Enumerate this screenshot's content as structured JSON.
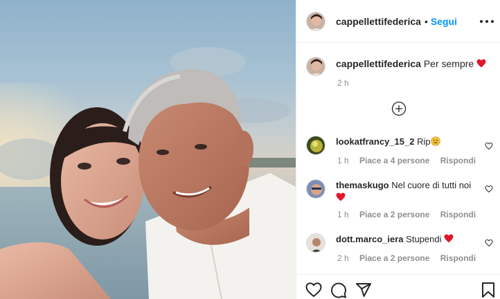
{
  "post": {
    "username": "cappellettifederica",
    "separator": "•",
    "follow_label": "Segui"
  },
  "caption": {
    "username": "cappellettifederica",
    "text": "Per sempre",
    "emoji": "red-heart",
    "time": "2 h"
  },
  "comments": [
    {
      "username": "lookatfrancy_15_2",
      "text": "Rip",
      "emoji": "frowning-face",
      "time": "1 h",
      "likes": "Piace a 4 persone",
      "reply_label": "Rispondi"
    },
    {
      "username": "themaskugo",
      "text": "Nel cuore di tutti noi",
      "emoji": "red-heart",
      "time": "1 h",
      "likes": "Piace a 2 persone",
      "reply_label": "Rispondi"
    },
    {
      "username": "dott.marco_iera",
      "text": "Stupendi",
      "emoji": "red-heart",
      "time": "2 h",
      "likes": "Piace a 2 persone",
      "reply_label": "Rispondi"
    }
  ],
  "icons": {
    "more": "more-options-icon",
    "load_more": "plus-circle-icon",
    "like": "heart-outline-icon",
    "comment": "comment-bubble-icon",
    "share": "paper-plane-icon",
    "save": "bookmark-icon"
  },
  "colors": {
    "link_blue": "#0095f6",
    "heart_red": "#ed4956",
    "text": "#262626",
    "muted": "#8e8e8e",
    "divider": "#efefef"
  }
}
